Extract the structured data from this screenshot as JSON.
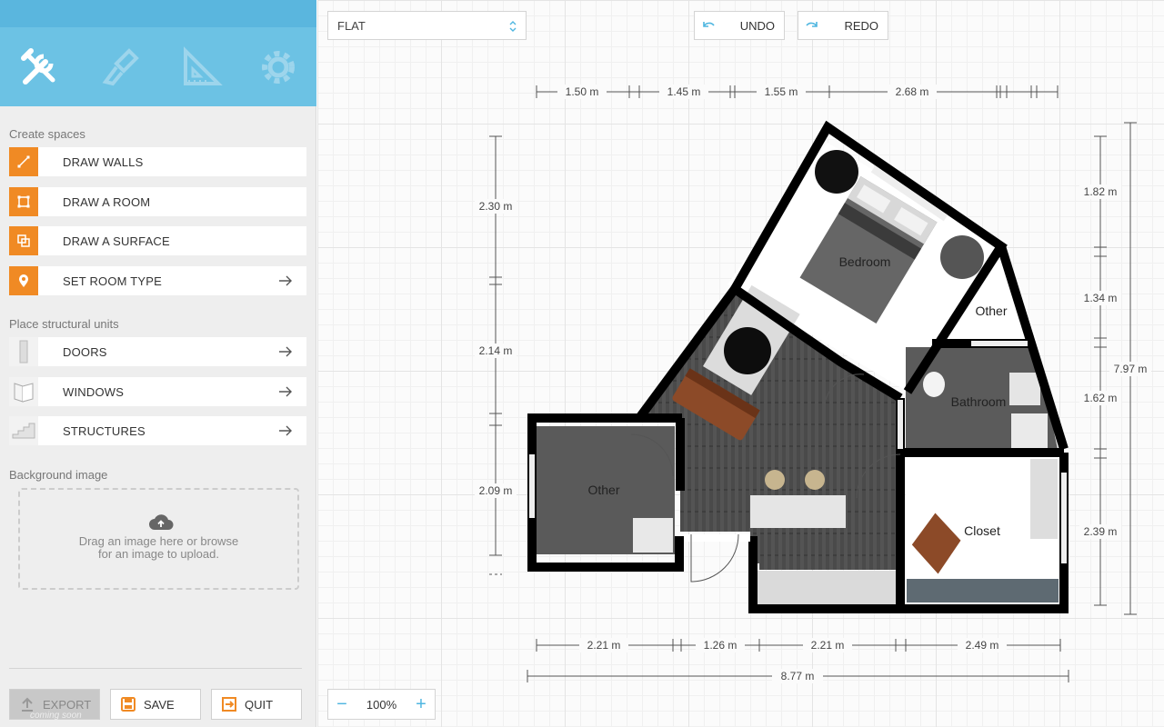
{
  "sidebar": {
    "tabs": [
      {
        "name": "build-tools-icon"
      },
      {
        "name": "paint-brush-icon"
      },
      {
        "name": "ruler-triangle-icon"
      },
      {
        "name": "settings-gear-icon"
      }
    ],
    "create_spaces_title": "Create spaces",
    "create_tools": [
      {
        "label": "DRAW WALLS",
        "icon": "draw-walls-icon"
      },
      {
        "label": "DRAW A ROOM",
        "icon": "draw-room-icon"
      },
      {
        "label": "DRAW A SURFACE",
        "icon": "draw-surface-icon"
      },
      {
        "label": "SET ROOM TYPE",
        "icon": "location-pin-icon"
      }
    ],
    "structural_title": "Place structural units",
    "structural_tools": [
      {
        "label": "DOORS",
        "icon": "door-thumbnail-icon"
      },
      {
        "label": "WINDOWS",
        "icon": "window-thumbnail-icon"
      },
      {
        "label": "STRUCTURES",
        "icon": "stairs-thumbnail-icon"
      }
    ],
    "background_title": "Background image",
    "upload_line1": "Drag an image here or browse",
    "upload_line2": "for an image to upload.",
    "footer": {
      "export_label": "EXPORT",
      "export_note": "coming soon",
      "save_label": "SAVE",
      "quit_label": "QUIT"
    }
  },
  "toolbar": {
    "level_value": "FLAT",
    "undo_label": "UNDO",
    "redo_label": "REDO"
  },
  "zoom": {
    "minus": "−",
    "value": "100%",
    "plus": "+"
  },
  "plan": {
    "rooms": [
      "Bedroom",
      "Other",
      "Bathroom",
      "Other",
      "Closet"
    ],
    "dims_top": [
      "1.50 m",
      "1.45 m",
      "1.55 m",
      "2.68 m"
    ],
    "dims_left": [
      "2.30 m",
      "2.14 m",
      "2.09 m"
    ],
    "dims_right": [
      "1.82 m",
      "1.34 m",
      "1.62 m",
      "2.39 m"
    ],
    "dim_total_right": "7.97 m",
    "dims_bottom": [
      "2.21 m",
      "1.26 m",
      "2.21 m",
      "2.49 m"
    ],
    "dim_total_bottom": "8.77 m"
  }
}
